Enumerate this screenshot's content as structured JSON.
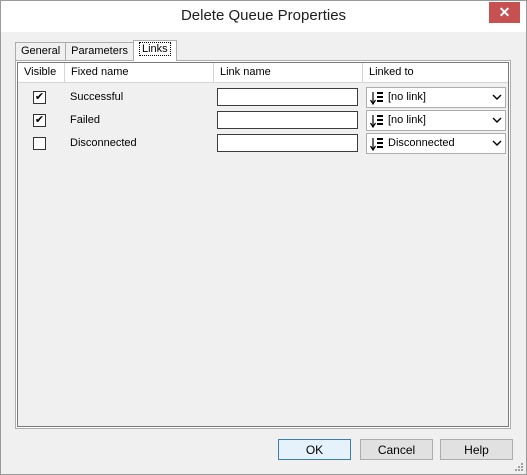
{
  "window": {
    "title": "Delete Queue Properties",
    "close_glyph": "✕"
  },
  "tabs": [
    {
      "label": "General",
      "active": false
    },
    {
      "label": "Parameters",
      "active": false
    },
    {
      "label": "Links",
      "active": true
    }
  ],
  "grid": {
    "columns": [
      "Visible",
      "Fixed name",
      "Link name",
      "Linked to"
    ],
    "rows": [
      {
        "visible": true,
        "fixed_name": "Successful",
        "link_name": "",
        "linked_to": "[no link]"
      },
      {
        "visible": true,
        "fixed_name": "Failed",
        "link_name": "",
        "linked_to": "[no link]"
      },
      {
        "visible": false,
        "fixed_name": "Disconnected",
        "link_name": "",
        "linked_to": "Disconnected"
      }
    ]
  },
  "buttons": {
    "ok": "OK",
    "cancel": "Cancel",
    "help": "Help"
  },
  "icons": {
    "link_selector": "sort-arrow-list-icon",
    "dropdown": "chevron-down-icon"
  },
  "colors": {
    "close_button": "#c75050",
    "default_button_border": "#3c7fb1"
  }
}
